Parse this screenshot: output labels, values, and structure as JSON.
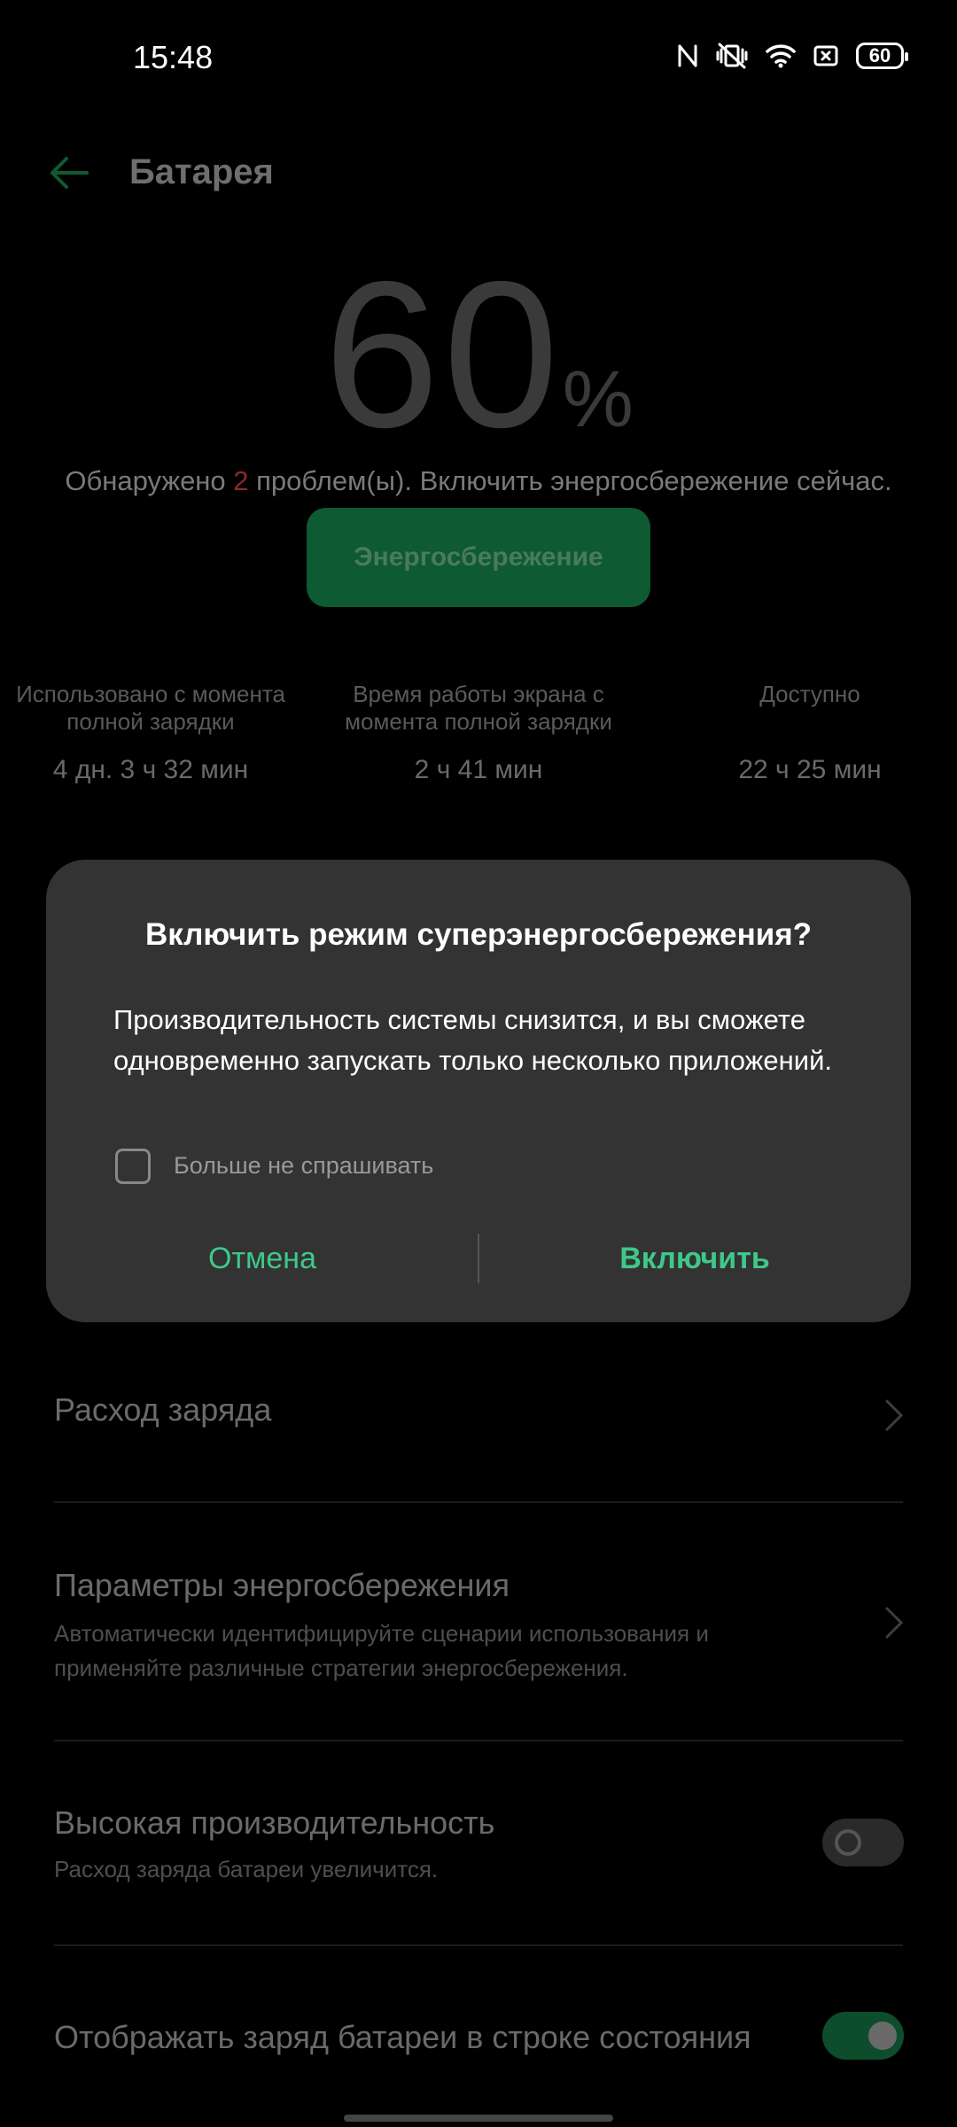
{
  "status_bar": {
    "time": "15:48",
    "battery_level": "60",
    "icons": [
      "nfc-icon",
      "vibrate-icon",
      "wifi-icon",
      "sim-icon",
      "battery-icon"
    ]
  },
  "header": {
    "title": "Батарея",
    "back_icon": "arrow-left-icon"
  },
  "battery": {
    "percent_value": "60",
    "percent_sign": "%",
    "problems_prefix": "Обнаружено ",
    "problems_count": "2",
    "problems_suffix": " проблем(ы). Включить энергосбережение сейчас.",
    "saver_button_label": "Энергосбережение"
  },
  "stats": [
    {
      "label": "Использовано с момента полной зарядки",
      "value": "4 дн. 3 ч 32 мин"
    },
    {
      "label": "Время работы экрана с момента полной зарядки",
      "value": "2 ч 41 мин"
    },
    {
      "label": "Доступно",
      "value": "22 ч 25 мин"
    }
  ],
  "dialog": {
    "title": "Включить режим суперэнергосбережения?",
    "message": "Производительность системы снизится, и вы сможете одновременно запускать только несколько приложений.",
    "checkbox_label": "Больше не спрашивать",
    "checkbox_checked": false,
    "cancel_label": "Отмена",
    "confirm_label": "Включить"
  },
  "settings": [
    {
      "title": "Расход заряда",
      "subtitle": "",
      "control": "chevron"
    },
    {
      "title": "Параметры энергосбережения",
      "subtitle": "Автоматически идентифицируйте сценарии использования и применяйте различные стратегии энергосбережения.",
      "control": "chevron"
    },
    {
      "title": "Высокая производительность",
      "subtitle": "Расход заряда батареи увеличится.",
      "control": "toggle",
      "enabled": false
    },
    {
      "title": "Отображать заряд батареи в строке состояния",
      "subtitle": "",
      "control": "toggle",
      "enabled": true
    }
  ],
  "colors": {
    "accent": "#3fc88a",
    "dialog_bg": "#333333",
    "background": "#000000"
  }
}
